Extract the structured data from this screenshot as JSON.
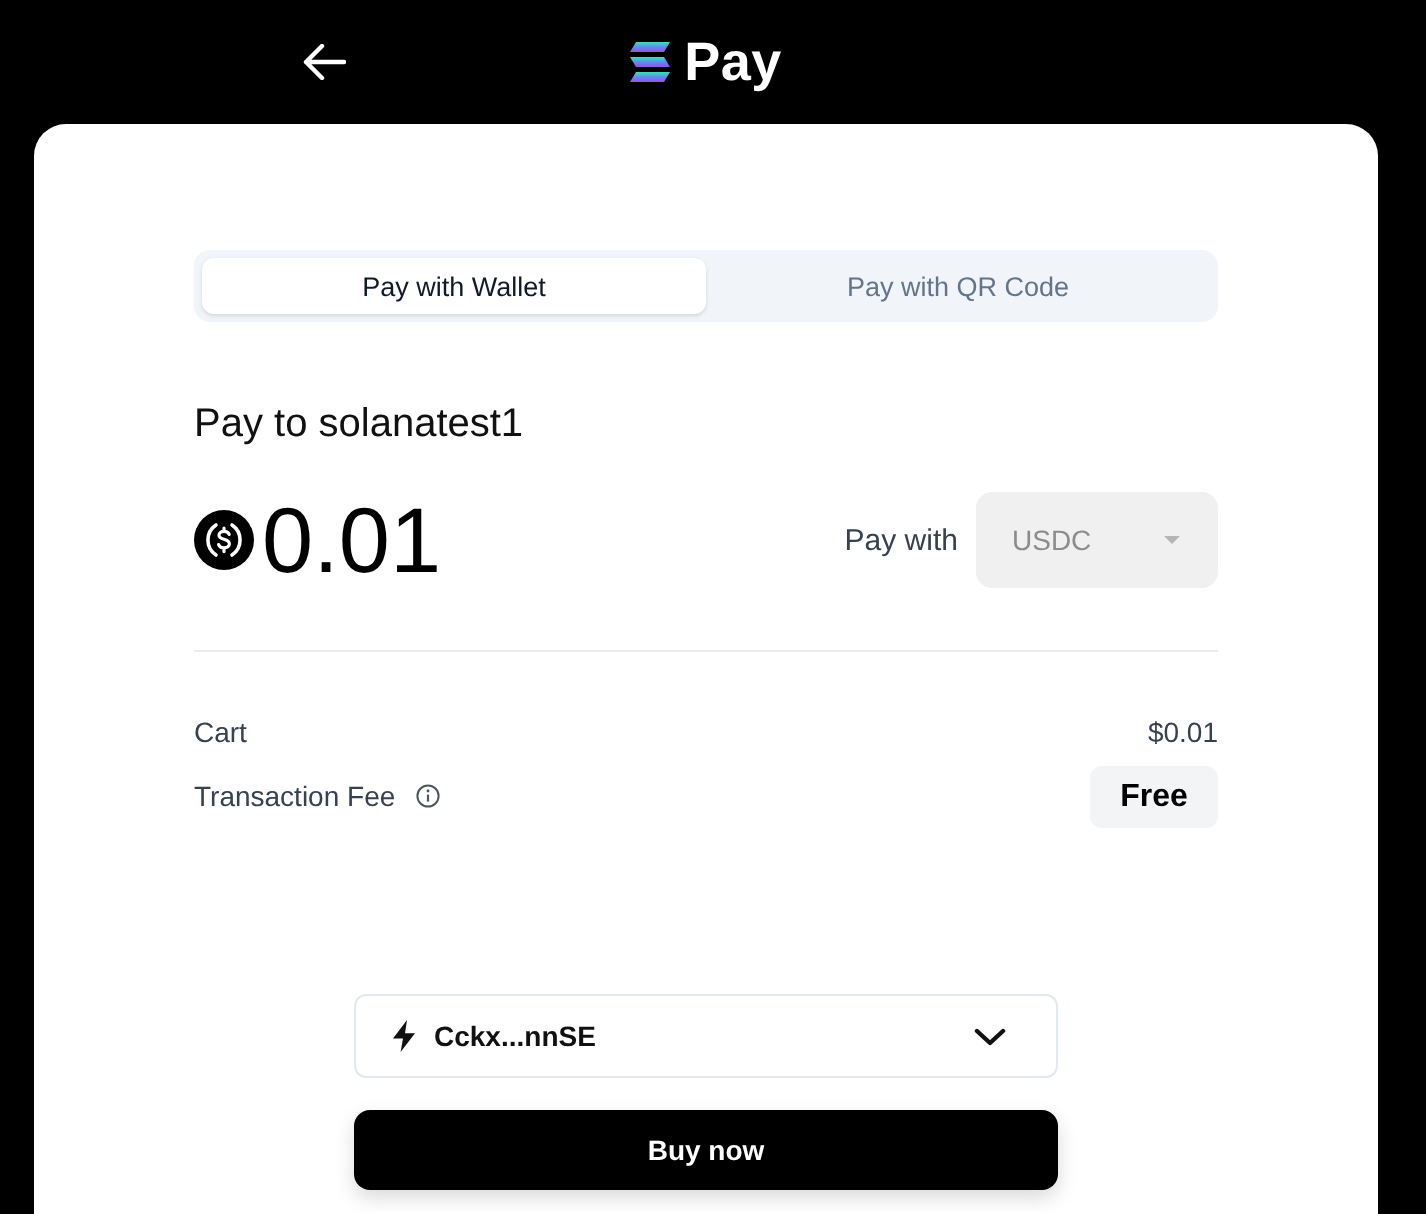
{
  "header": {
    "title": "Pay"
  },
  "tabs": [
    {
      "label": "Pay with Wallet",
      "selected": true
    },
    {
      "label": "Pay with QR Code",
      "selected": false
    }
  ],
  "payee": "Pay to solanatest1",
  "amount": "0.01",
  "currency_select": {
    "label": "Pay with",
    "value": "USDC",
    "disabled": true
  },
  "summary": [
    {
      "kind": "text",
      "label": "Cart",
      "value": "$0.01",
      "info": false
    },
    {
      "kind": "chip",
      "label": "Transaction Fee",
      "value": "Free",
      "info": true
    }
  ],
  "wallet_select": {
    "value": "Cckx...nnSE"
  },
  "buy_button": {
    "label": "Buy now"
  }
}
